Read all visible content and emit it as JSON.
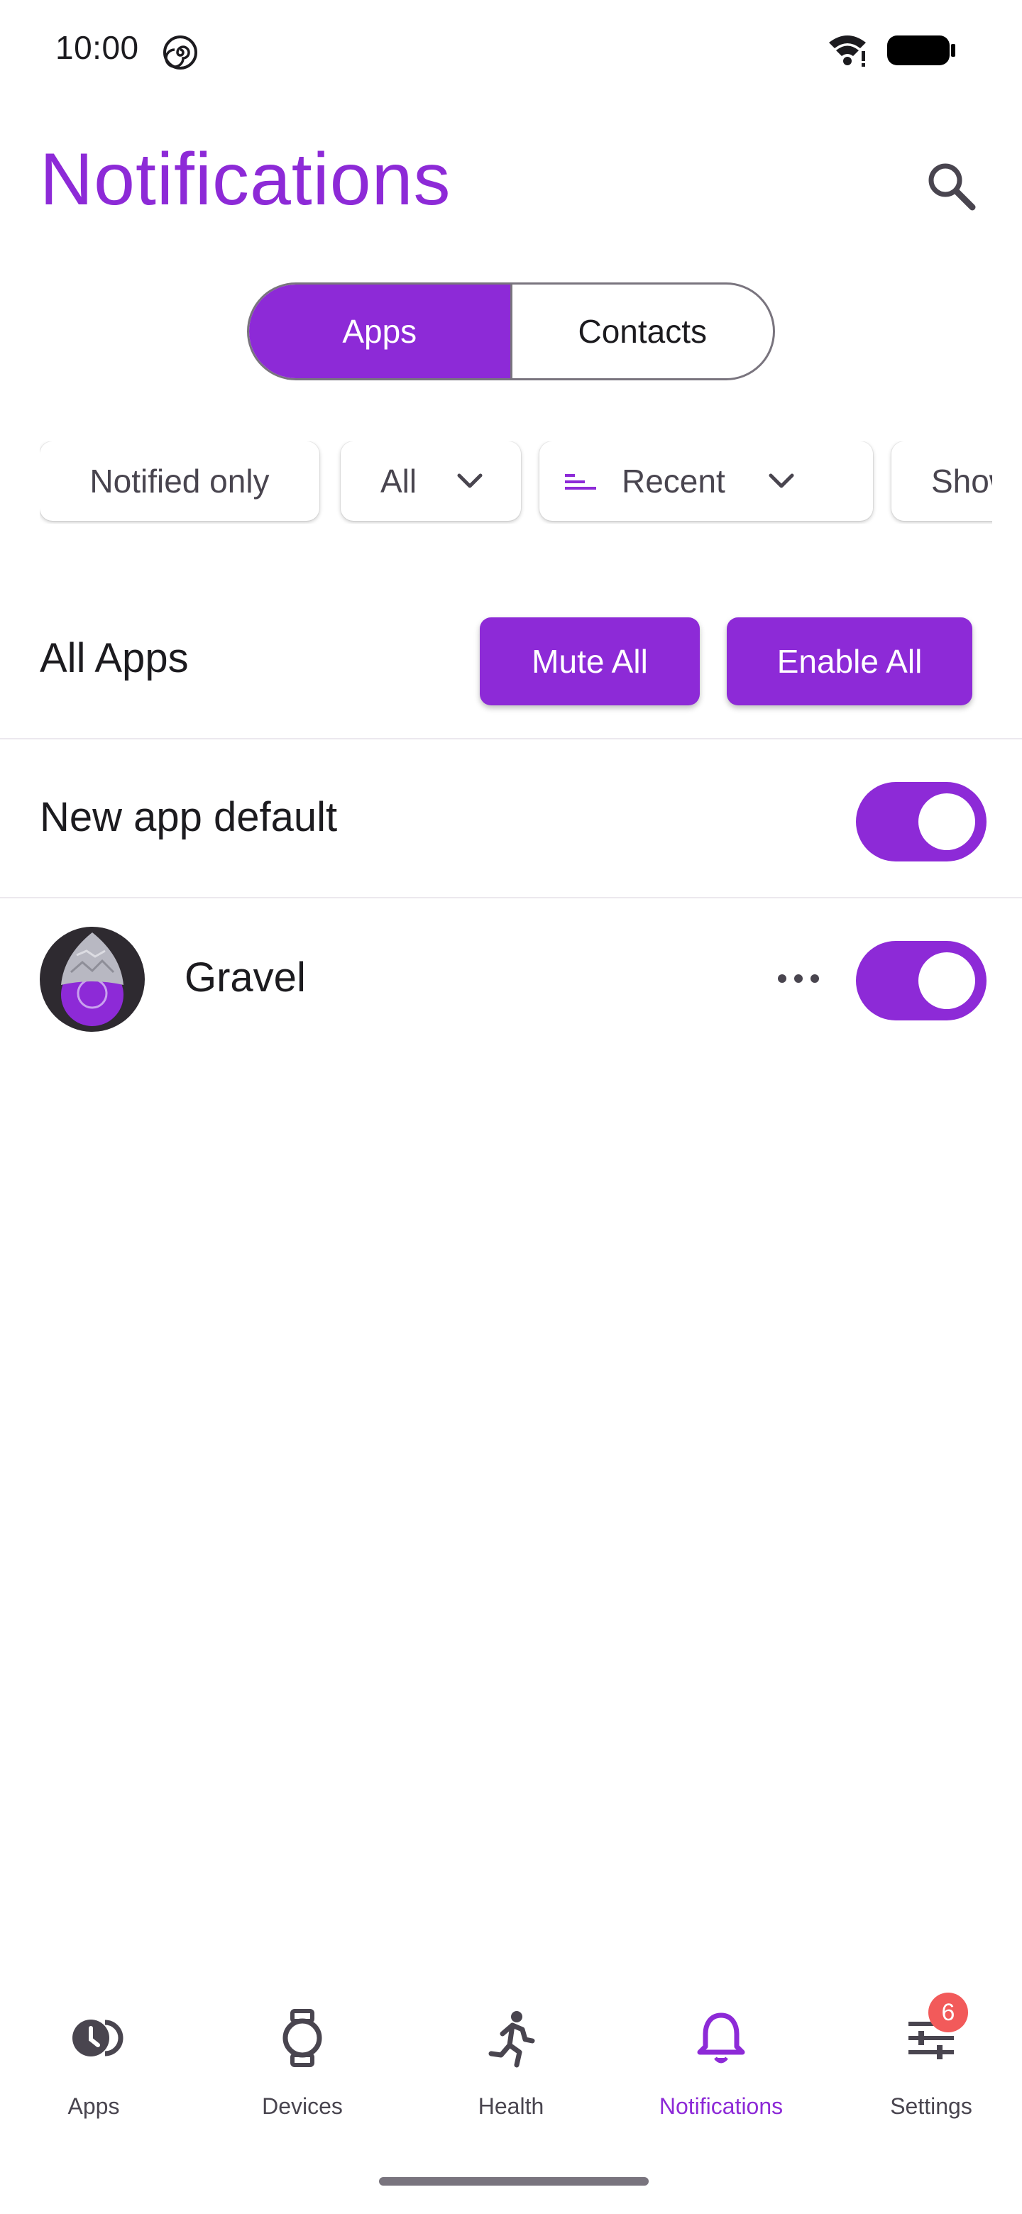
{
  "status_bar": {
    "time": "10:00"
  },
  "header": {
    "title": "Notifications"
  },
  "segmented": {
    "apps_label": "Apps",
    "contacts_label": "Contacts"
  },
  "filters": {
    "notified_only": "Notified only",
    "all_value": "All",
    "sort_value": "Recent",
    "show_partial": "Show s"
  },
  "all_apps": {
    "label": "All Apps",
    "mute_all": "Mute All",
    "enable_all": "Enable All"
  },
  "new_app_default": {
    "label": "New app default",
    "enabled": true
  },
  "apps": [
    {
      "name": "Gravel",
      "enabled": true
    }
  ],
  "bottom_nav": {
    "items": [
      {
        "label": "Apps",
        "icon": "apps-icon"
      },
      {
        "label": "Devices",
        "icon": "watch-icon"
      },
      {
        "label": "Health",
        "icon": "running-icon"
      },
      {
        "label": "Notifications",
        "icon": "bell-icon"
      },
      {
        "label": "Settings",
        "icon": "settings-sliders-icon",
        "badge": "6"
      }
    ],
    "active": "Notifications"
  },
  "colors": {
    "accent": "#8d2ad7",
    "badge": "#f25a5a",
    "text": "#1c1b1f",
    "muted": "#49454f"
  }
}
